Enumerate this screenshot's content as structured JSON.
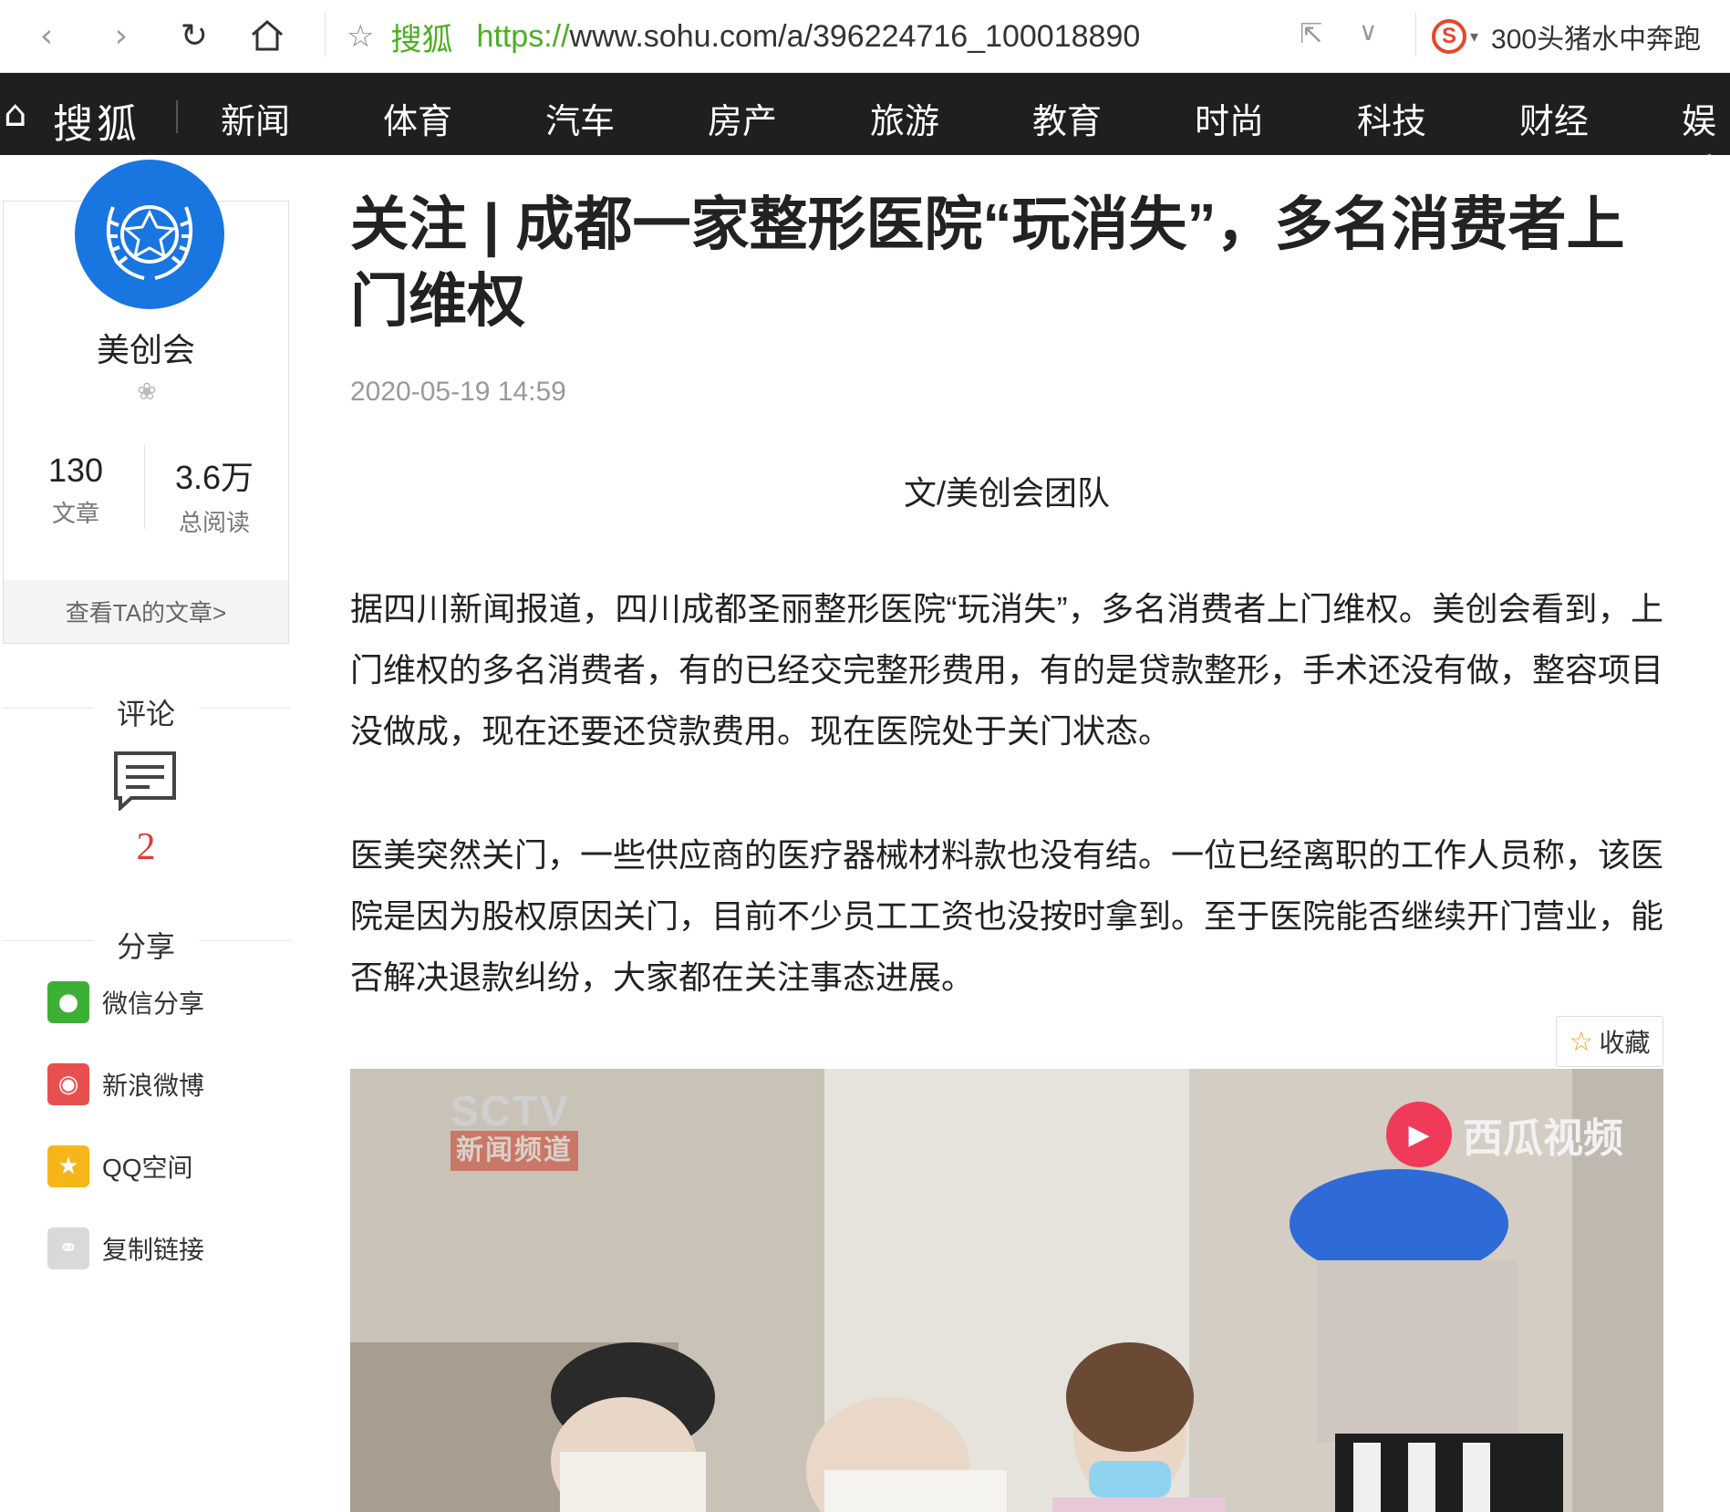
{
  "browser": {
    "back_icon": "back-arrow-icon",
    "forward_icon": "forward-arrow-icon",
    "reload_icon": "reload-icon",
    "home_icon": "home-icon",
    "bookmark_icon": "star-icon",
    "site_name": "搜狐",
    "url_scheme": "https://",
    "url_rest": "www.sohu.com/a/396224716_100018890",
    "search_text": "300头猪水中奔跑"
  },
  "topnav": {
    "brand": "搜狐",
    "items": [
      "新闻",
      "体育",
      "汽车",
      "房产",
      "旅游",
      "教育",
      "时尚",
      "科技",
      "财经",
      "娱乐"
    ]
  },
  "author": {
    "name": "美创会",
    "articles_count": "130",
    "articles_label": "文章",
    "reads_count": "3.6万",
    "reads_label": "总阅读",
    "view_articles": "查看TA的文章>"
  },
  "comments": {
    "title": "评论",
    "count": "2"
  },
  "share": {
    "title": "分享",
    "items": [
      {
        "label": "微信分享",
        "icon": "wechat-icon",
        "color": "#3cb034"
      },
      {
        "label": "新浪微博",
        "icon": "weibo-icon",
        "color": "#e8504f"
      },
      {
        "label": "QQ空间",
        "icon": "qzone-icon",
        "color": "#f6b619"
      },
      {
        "label": "复制链接",
        "icon": "link-icon",
        "color": "#d9d9d9"
      }
    ]
  },
  "article": {
    "title": "关注 | 成都一家整形医院“玩消失”，多名消费者上门维权",
    "time": "2020-05-19 14:59",
    "byline": "文/美创会团队",
    "paragraphs": [
      "据四川新闻报道，四川成都圣丽整形医院“玩消失”，多名消费者上门维权。美创会看到，上门维权的多名消费者，有的已经交完整形费用，有的是贷款整形，手术还没有做，整容项目没做成，现在还要还贷款费用。现在医院处于关门状态。",
      "医美突然关门，一些供应商的医疗器械材料款也没有结。一位已经离职的工作人员称，该医院是因为股权原因关门，目前不少员工工资也没按时拿到。至于医院能否继续开门营业，能否解决退款纠纷，大家都在关注事态进展。"
    ],
    "favorite_label": "收藏"
  },
  "video": {
    "watermark_top": "SCTV",
    "watermark_sub": "新闻频道",
    "platform": "西瓜视频"
  },
  "colors": {
    "nav_bg": "#1f1f1f",
    "avatar_blue": "#1976e0",
    "comment_count": "#e53935",
    "url_green": "#4caf22"
  }
}
